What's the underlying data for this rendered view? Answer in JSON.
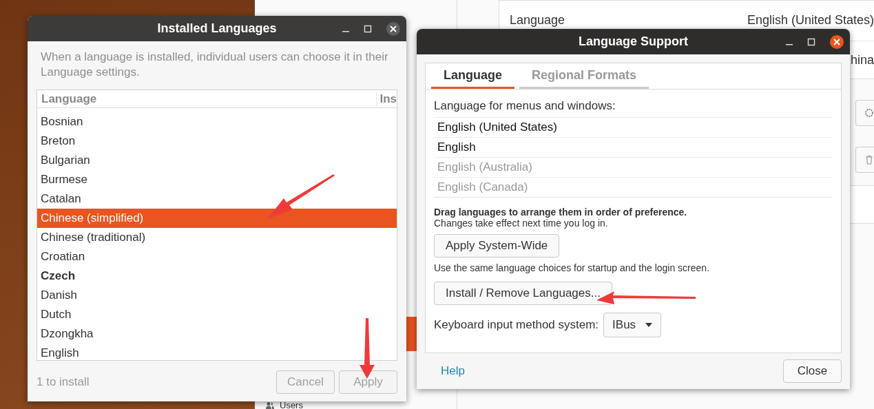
{
  "settings_backdrop": {
    "rows": [
      {
        "label": "Language",
        "value": "English (United States)"
      },
      {
        "value": "hina"
      }
    ],
    "sidebar": [
      {
        "selected": true
      },
      {
        "label": "Users",
        "selected": false
      }
    ]
  },
  "installed_languages": {
    "title": "Installed Languages",
    "active": false,
    "description": "When a language is installed, individual users can choose it in their Language settings.",
    "columns": [
      "Language",
      "Ins"
    ],
    "rows": [
      {
        "label": "Bosnian",
        "selected": false,
        "bold": false
      },
      {
        "label": "Breton",
        "selected": false,
        "bold": false
      },
      {
        "label": "Bulgarian",
        "selected": false,
        "bold": false
      },
      {
        "label": "Burmese",
        "selected": false,
        "bold": false
      },
      {
        "label": "Catalan",
        "selected": false,
        "bold": false
      },
      {
        "label": "Chinese (simplified)",
        "selected": true,
        "bold": false
      },
      {
        "label": "Chinese (traditional)",
        "selected": false,
        "bold": false
      },
      {
        "label": "Croatian",
        "selected": false,
        "bold": false
      },
      {
        "label": "Czech",
        "selected": false,
        "bold": true
      },
      {
        "label": "Danish",
        "selected": false,
        "bold": false
      },
      {
        "label": "Dutch",
        "selected": false,
        "bold": false
      },
      {
        "label": "Dzongkha",
        "selected": false,
        "bold": false
      },
      {
        "label": "English",
        "selected": false,
        "bold": false
      }
    ],
    "status": "1 to install",
    "buttons": [
      {
        "label": "Cancel",
        "disabled": true
      },
      {
        "label": "Apply",
        "disabled": true
      }
    ]
  },
  "language_support": {
    "title": "Language Support",
    "active": true,
    "tabs": [
      {
        "label": "Language",
        "selected": true
      },
      {
        "label": "Regional Formats",
        "selected": false
      }
    ],
    "menu_label": "Language for menus and windows:",
    "languages": [
      {
        "label": "English (United States)",
        "installed": true
      },
      {
        "label": "English",
        "installed": true
      },
      {
        "label": "English (Australia)",
        "installed": false
      },
      {
        "label": "English (Canada)",
        "installed": false
      }
    ],
    "drag_hint": "Drag languages to arrange them in order of preference.",
    "note": "Changes take effect next time you log in.",
    "apply_button": "Apply System-Wide",
    "apply_hint": "Use the same language choices for startup and the login screen.",
    "install_button": "Install / Remove Languages...",
    "input_method_label": "Keyboard input method system:",
    "input_method": "IBus",
    "help": "Help",
    "close": "Close"
  }
}
